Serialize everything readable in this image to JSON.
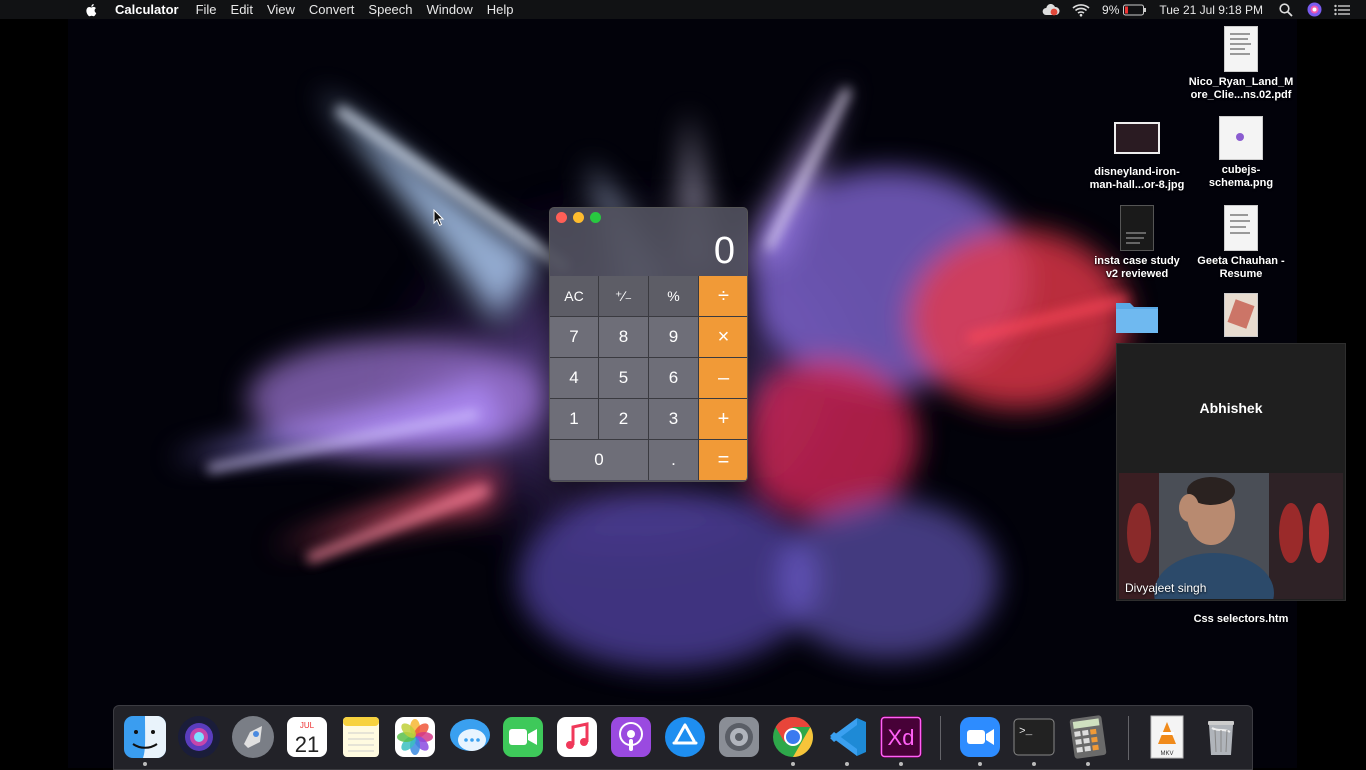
{
  "menubar": {
    "app_name": "Calculator",
    "menus": [
      "File",
      "Edit",
      "View",
      "Convert",
      "Speech",
      "Window",
      "Help"
    ],
    "battery": "9%",
    "datetime": "Tue 21 Jul  9:18 PM"
  },
  "desktop_icons": [
    {
      "label": "Nico_Ryan_Land_M\nore_Clie...ns.02.pdf"
    },
    {
      "label": "disneyland-iron-\nman-hall...or-8.jpg"
    },
    {
      "label": "cubejs-\nschema.png"
    },
    {
      "label": "insta case study\nv2 reviewed"
    },
    {
      "label": "Geeta Chauhan -\nResume"
    },
    {
      "label": "Css selectors.htm"
    }
  ],
  "calculator": {
    "display": "0",
    "keys": [
      "AC",
      "⁺∕₋",
      "%",
      "÷",
      "7",
      "8",
      "9",
      "×",
      "4",
      "5",
      "6",
      "–",
      "1",
      "2",
      "3",
      "+",
      "0",
      ".",
      "="
    ]
  },
  "video_call": {
    "host_name": "Abhishek",
    "participant_name": "Divyajeet singh"
  },
  "dock": {
    "items": [
      {
        "name": "Finder",
        "icon": "finder-icon"
      },
      {
        "name": "Siri",
        "icon": "siri-icon"
      },
      {
        "name": "Launchpad",
        "icon": "launchpad-icon"
      },
      {
        "name": "Calendar",
        "icon": "calendar-icon",
        "month": "JUL",
        "day": "21"
      },
      {
        "name": "Notes",
        "icon": "notes-icon"
      },
      {
        "name": "Photos",
        "icon": "photos-icon"
      },
      {
        "name": "Messages",
        "icon": "messages-icon"
      },
      {
        "name": "FaceTime",
        "icon": "facetime-icon"
      },
      {
        "name": "Music",
        "icon": "music-icon"
      },
      {
        "name": "Podcasts",
        "icon": "podcasts-icon"
      },
      {
        "name": "App Store",
        "icon": "app-store-icon"
      },
      {
        "name": "System Preferences",
        "icon": "system-preferences-icon"
      },
      {
        "name": "Chrome",
        "icon": "chrome-icon"
      },
      {
        "name": "VS Code",
        "icon": "vscode-icon"
      },
      {
        "name": "Adobe XD",
        "icon": "adobe-xd-icon",
        "text": "Xd"
      },
      {
        "name": "Zoom",
        "icon": "zoom-icon"
      },
      {
        "name": "Terminal",
        "icon": "terminal-icon",
        "text": ">_"
      },
      {
        "name": "Calculator",
        "icon": "calculator-icon"
      },
      {
        "name": "MKV file",
        "icon": "vlc-mkv-icon",
        "text": "MKV"
      },
      {
        "name": "Trash",
        "icon": "trash-icon"
      }
    ]
  },
  "colors": {
    "calc_operator": "#f19a37",
    "menubar_bg": "#111214"
  }
}
